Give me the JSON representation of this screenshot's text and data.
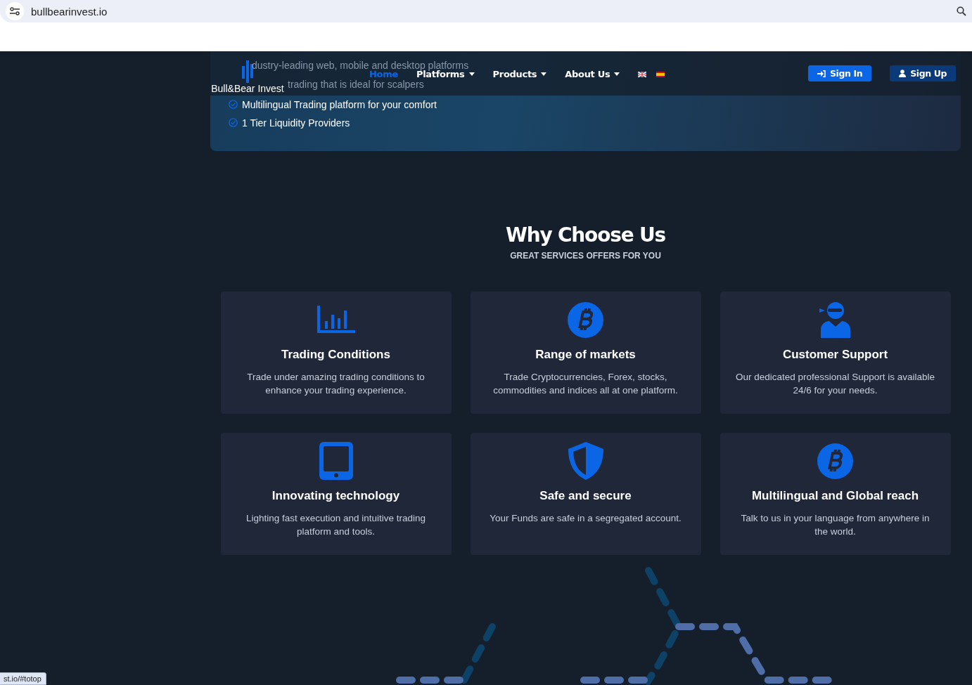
{
  "browser": {
    "url": "bullbearinvest.io"
  },
  "header": {
    "logo": "Bull&Bear Invest",
    "nav": [
      {
        "label": "Home",
        "selected": true,
        "dropdown": false
      },
      {
        "label": "Platforms",
        "selected": false,
        "dropdown": true
      },
      {
        "label": "Products",
        "selected": false,
        "dropdown": true
      },
      {
        "label": "About Us",
        "selected": false,
        "dropdown": true
      }
    ],
    "languages": [
      {
        "kind": "uk"
      },
      {
        "kind": "es"
      }
    ],
    "buttons": [
      {
        "label": "Sign In",
        "kind": "signin"
      },
      {
        "label": "Sign Up",
        "kind": "signup"
      }
    ]
  },
  "hero": {
    "faded_lines": [
      "dustry-leading web, mobile and desktop platforms",
      "trading that is ideal for scalpers"
    ],
    "features": [
      "Multilingual Trading platform for your comfort",
      "1 Tier Liquidity Providers"
    ]
  },
  "why": {
    "title": "Why Choose Us",
    "subtitle": "GREAT SERVICES OFFERS FOR YOU",
    "cards": [
      {
        "kind": "chart",
        "title": "Trading Conditions",
        "text": "Trade under amazing trading conditions to enhance your trading experience."
      },
      {
        "kind": "bitcoin",
        "title": "Range of markets",
        "text": "Trade Cryptocurrencies, Forex, stocks, commodities and indices all at one platform."
      },
      {
        "kind": "support",
        "title": "Customer Support",
        "text": "Our dedicated professional Support is available 24/6 for your needs."
      },
      {
        "kind": "tablet",
        "title": "Innovating technology",
        "text": "Lighting fast execution and intuitive trading platform and tools."
      },
      {
        "kind": "shield",
        "title": "Safe and secure",
        "text": "Your Funds are safe in a segregated account."
      },
      {
        "kind": "bitcoin",
        "title": "Multilingual and Global reach",
        "text": "Talk to us in your language from anywhere in the world."
      }
    ]
  },
  "status_url": "st.io/#totop"
}
